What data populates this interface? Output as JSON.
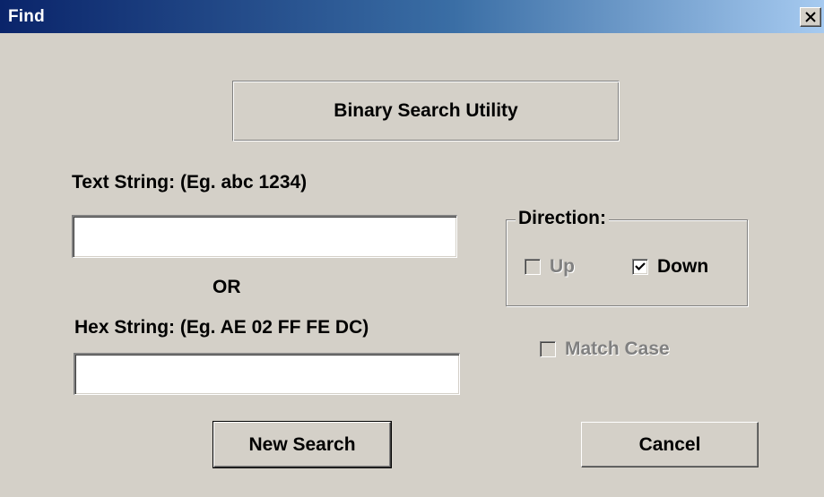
{
  "window": {
    "title": "Find",
    "close_icon": "close-icon"
  },
  "heading": "Binary Search Utility",
  "text_string": {
    "label": "Text String: (Eg. abc 1234)",
    "value": ""
  },
  "or_label": "OR",
  "hex_string": {
    "label": "Hex String: (Eg.  AE 02 FF FE DC)",
    "value": ""
  },
  "direction": {
    "legend": "Direction:",
    "up": {
      "label": "Up",
      "checked": false,
      "disabled": true
    },
    "down": {
      "label": "Down",
      "checked": true,
      "disabled": false
    }
  },
  "match_case": {
    "label": "Match Case",
    "checked": false,
    "disabled": true
  },
  "buttons": {
    "new_search": "New Search",
    "cancel": "Cancel"
  },
  "colors": {
    "face": "#d4d0c8",
    "title_start": "#0a246a",
    "title_end": "#a6caf0",
    "disabled_text": "#808080"
  }
}
